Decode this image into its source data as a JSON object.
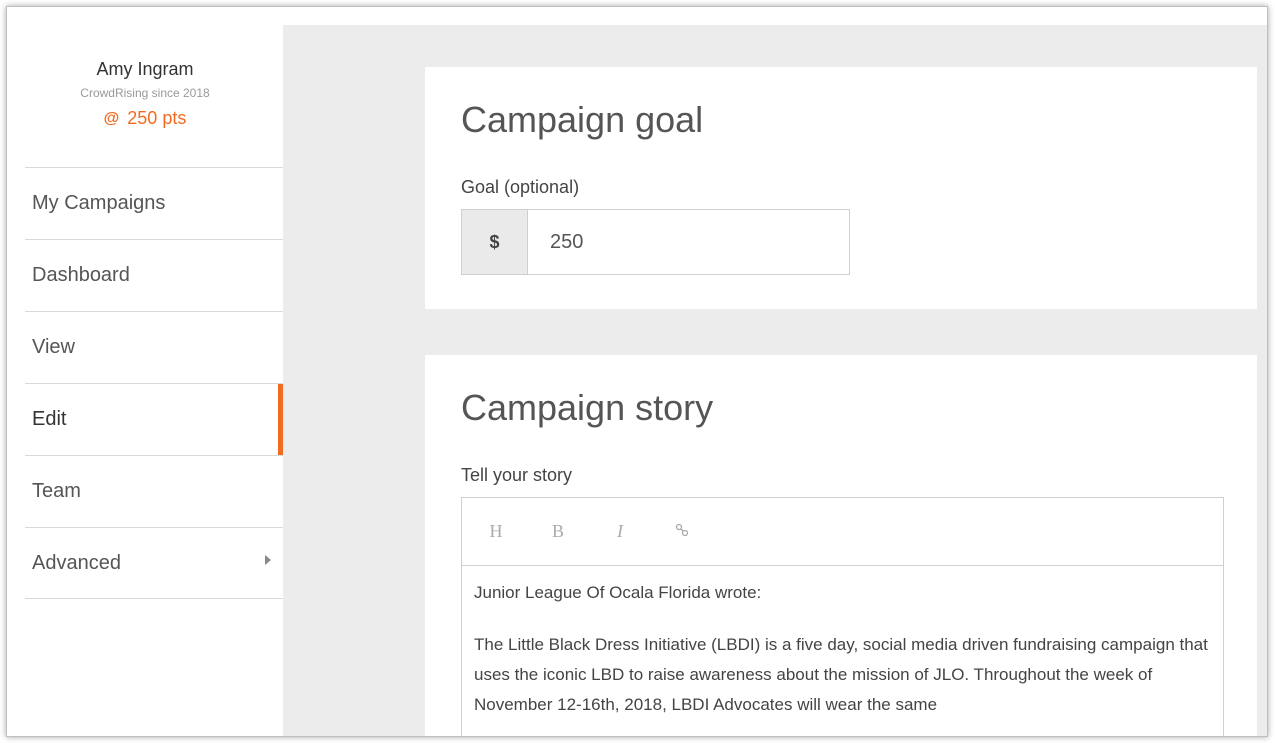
{
  "profile": {
    "name": "Amy Ingram",
    "since": "CrowdRising since 2018",
    "points_icon": "@",
    "points": "250 pts"
  },
  "nav": {
    "items": [
      {
        "label": "My Campaigns"
      },
      {
        "label": "Dashboard"
      },
      {
        "label": "View"
      },
      {
        "label": "Edit",
        "active": true
      },
      {
        "label": "Team"
      },
      {
        "label": "Advanced",
        "has_submenu": true
      }
    ]
  },
  "goal": {
    "title": "Campaign goal",
    "label": "Goal (optional)",
    "currency": "$",
    "value": "250"
  },
  "story": {
    "title": "Campaign story",
    "label": "Tell your story",
    "toolbar": {
      "heading": "H",
      "bold": "B",
      "italic": "I",
      "link_icon": "link-icon"
    },
    "line1": "Junior League Of Ocala Florida wrote:",
    "paragraph": "The Little Black Dress Initiative (LBDI) is a five day, social media driven fundraising campaign that uses the iconic LBD to raise awareness about the mission of JLO. Throughout the week of November 12-16th, 2018, LBDI Advocates will wear the same"
  },
  "colors": {
    "accent": "#f26b21"
  }
}
